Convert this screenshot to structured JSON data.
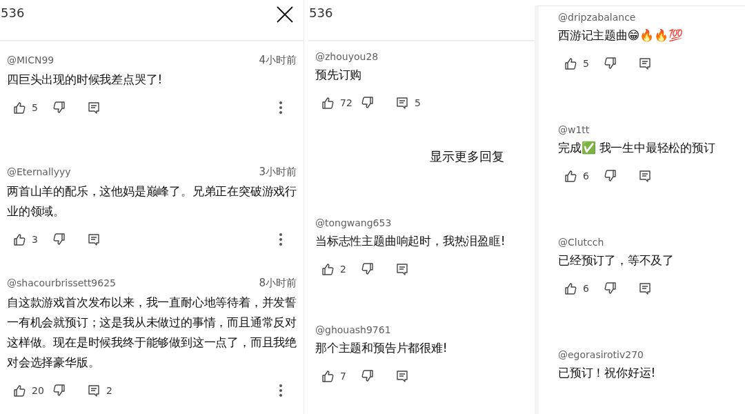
{
  "panels": [
    {
      "header": {
        "count": "536",
        "close": true
      },
      "items": [
        {
          "kind": "comment",
          "user": "@MICN99",
          "time": "4小时前",
          "text": "四巨头出现的时候我差点哭了!",
          "likes": "5",
          "menu": true,
          "actions": true
        },
        {
          "kind": "comment",
          "user": "@Eternallyyy",
          "time": "3小时前",
          "text": "两首山羊的配乐，这他妈是巅峰了。兄弟正在突破游戏行业的领域。",
          "likes": "3",
          "menu": true,
          "actions": true
        },
        {
          "kind": "comment",
          "user": "@shacourbrissett9625",
          "time": "8小时前",
          "text": "自这款游戏首次发布以来，我一直耐心地等待着，并发誓一有机会就预订；这是我从未做过的事情，而且通常反对这样做。现在是时候我终于能够做到这一点了，而且我绝对会选择豪华版。",
          "likes": "20",
          "replies": "2",
          "menu": true,
          "actions": true
        }
      ]
    },
    {
      "header": {
        "count": "536",
        "close": false
      },
      "items": [
        {
          "kind": "comment",
          "user": "@zhouyou28",
          "text": "预先订购",
          "likes": "72",
          "replies": "5",
          "menu": false,
          "actions": true
        },
        {
          "kind": "show_more",
          "label": "显示更多回复"
        },
        {
          "kind": "comment",
          "user": "@tongwang653",
          "text": "当标志性主题曲响起时，我热泪盈眶!",
          "likes": "2",
          "menu": false,
          "actions": true
        },
        {
          "kind": "comment",
          "user": "@ghouash9761",
          "text": "那个主题和预告片都很难!",
          "likes": "7",
          "menu": false,
          "actions": true
        }
      ]
    },
    {
      "items": [
        {
          "kind": "comment",
          "user": "@dripzabalance",
          "text": "西游记主题曲😁🔥🔥💯",
          "likes": "5",
          "menu": false,
          "actions": true
        },
        {
          "kind": "comment",
          "user": "@w1tt",
          "text": "完成✅ 我一生中最轻松的预订",
          "likes": "6",
          "menu": false,
          "actions": true
        },
        {
          "kind": "comment",
          "user": "@Clutcch",
          "text": "已经预订了，等不及了",
          "likes": "6",
          "menu": false,
          "actions": true
        },
        {
          "kind": "comment",
          "user": "@egorasirotiv270",
          "text": "已预订！祝你好运!",
          "actions": false
        }
      ]
    }
  ]
}
